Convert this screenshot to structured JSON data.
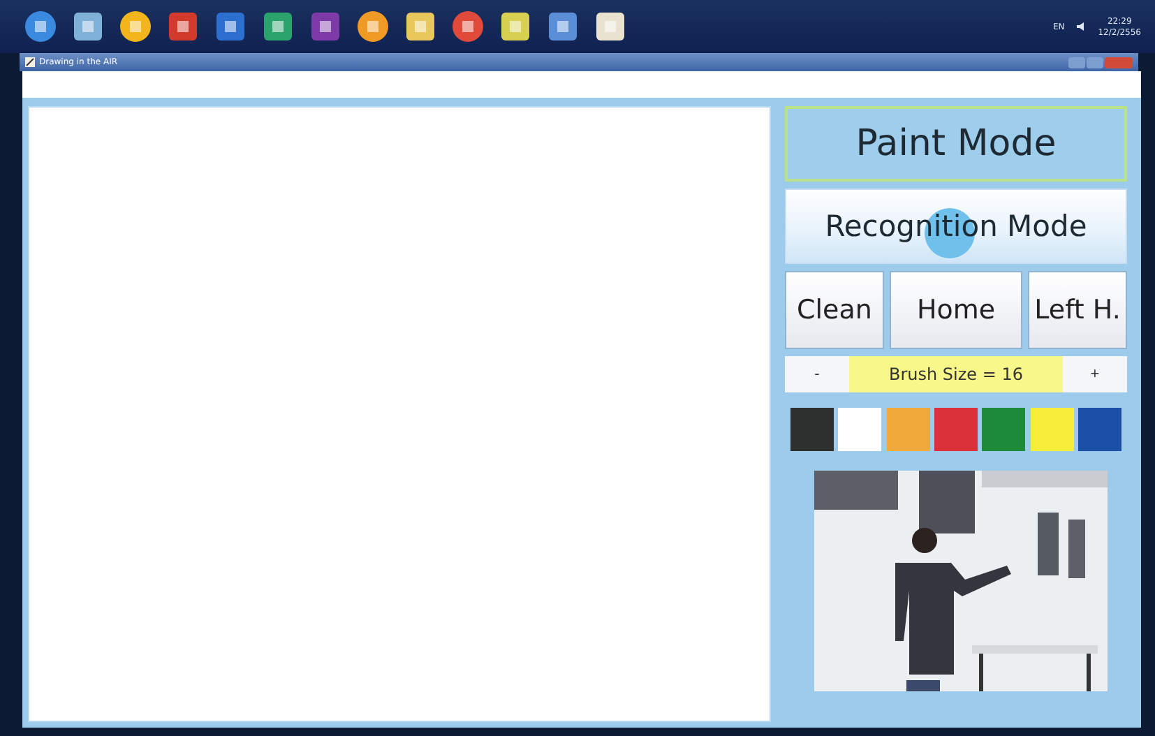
{
  "tray": {
    "language": "EN",
    "time": "22:29",
    "date": "12/2/2556"
  },
  "window": {
    "title": "Drawing in the AIR"
  },
  "modes": [
    {
      "label": "Paint Mode",
      "selected": true
    },
    {
      "label": "Recognition Mode",
      "selected": false
    }
  ],
  "actions": [
    "Clean",
    "Home",
    "Left H."
  ],
  "brush": {
    "decrease": "-",
    "label": "Brush Size = 16",
    "increase": "+"
  },
  "palette": [
    {
      "color": "#2d302e"
    },
    {
      "color": "#ffffff"
    },
    {
      "color": "#f0a83a"
    },
    {
      "color": "#d9303a"
    },
    {
      "color": "#1e8a3c"
    },
    {
      "color": "#f7ee3a"
    },
    {
      "color": "#1c4fa6"
    }
  ]
}
